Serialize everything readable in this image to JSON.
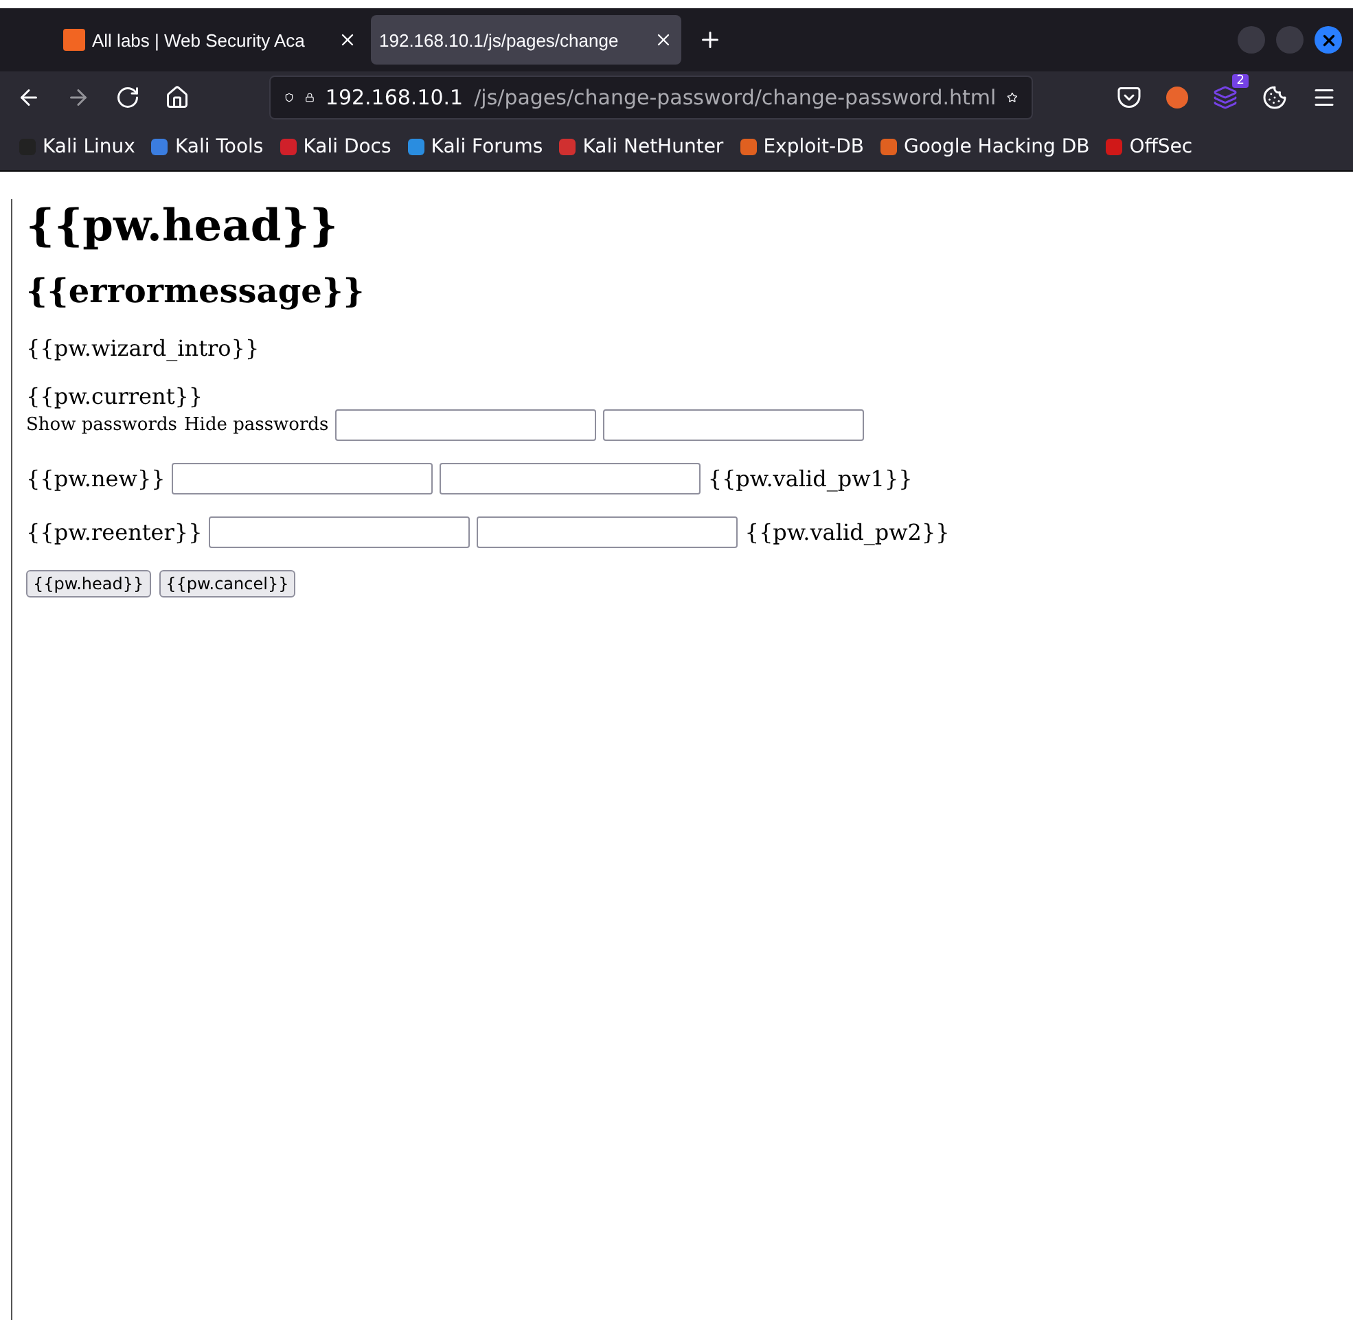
{
  "tabs": [
    {
      "title": "All labs | Web Security Aca",
      "selected": false
    },
    {
      "title": "192.168.10.1/js/pages/change",
      "selected": true
    }
  ],
  "address": {
    "host": "192.168.10.1",
    "path": "/js/pages/change-password/change-password.html"
  },
  "extension_badge": "2",
  "bookmarks": [
    {
      "label": "Kali Linux",
      "color": "#222222"
    },
    {
      "label": "Kali Tools",
      "color": "#3b7de0"
    },
    {
      "label": "Kali Docs",
      "color": "#d0202a"
    },
    {
      "label": "Kali Forums",
      "color": "#2a8de0"
    },
    {
      "label": "Kali NetHunter",
      "color": "#d03030"
    },
    {
      "label": "Exploit-DB",
      "color": "#e06020"
    },
    {
      "label": "Google Hacking DB",
      "color": "#e06020"
    },
    {
      "label": "OffSec",
      "color": "#d01818"
    }
  ],
  "page": {
    "heading": "{{pw.head}}",
    "error": "{{errormessage}}",
    "intro": "{{pw.wizard_intro}}",
    "current": {
      "label": "{{pw.current}}",
      "show": "Show passwords",
      "hide": "Hide passwords"
    },
    "rows": [
      {
        "label": "{{pw.new}}",
        "validation": "{{pw.valid_pw1}}"
      },
      {
        "label": "{{pw.reenter}}",
        "validation": "{{pw.valid_pw2}}"
      }
    ],
    "buttons": [
      "{{pw.head}}",
      "{{pw.cancel}}"
    ]
  }
}
